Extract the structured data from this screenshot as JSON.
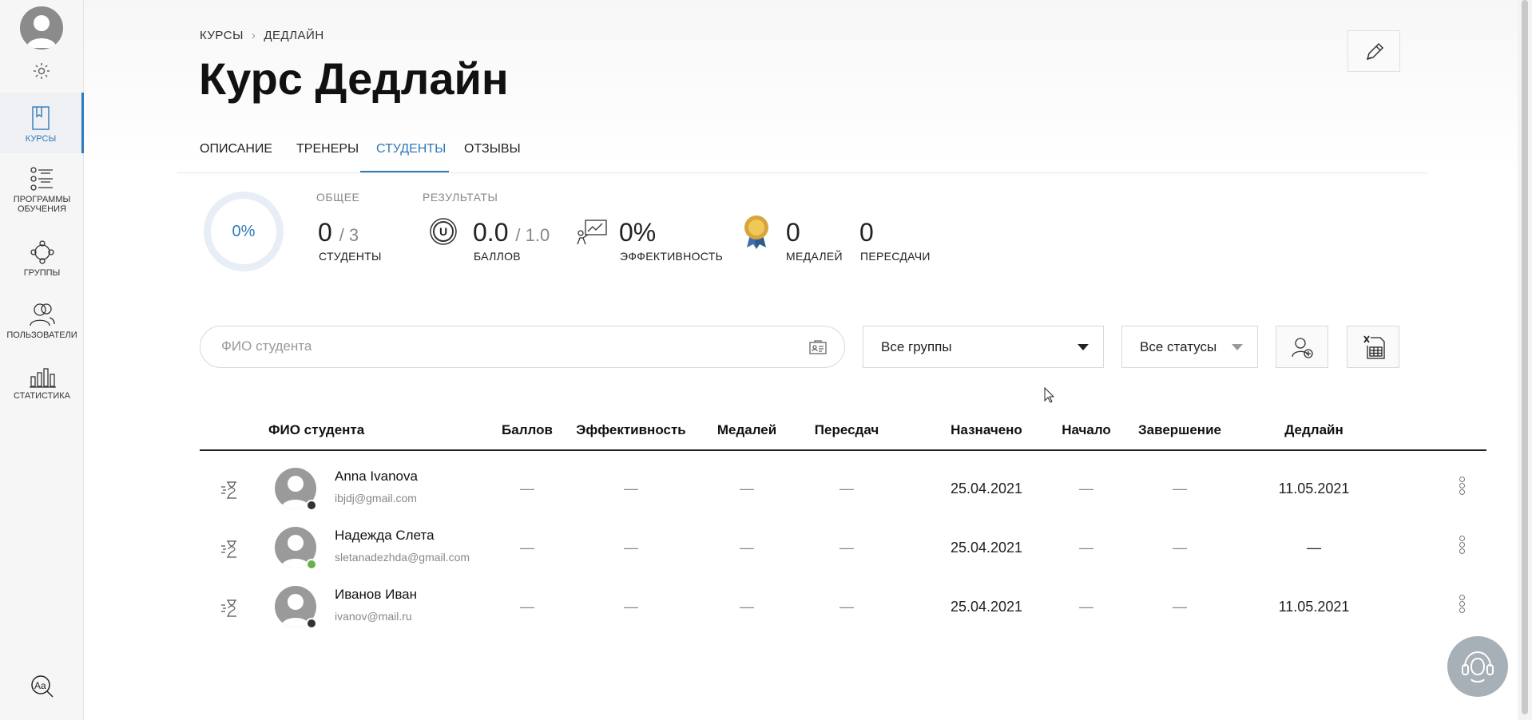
{
  "sidebar": {
    "items": [
      {
        "label": "КУРСЫ",
        "icon": "book-icon"
      },
      {
        "label": "ПРОГРАММЫ ОБУЧЕНИЯ",
        "icon": "checklist-icon"
      },
      {
        "label": "ГРУППЫ",
        "icon": "group-icon"
      },
      {
        "label": "ПОЛЬЗОВАТЕЛИ",
        "icon": "users-icon"
      },
      {
        "label": "СТАТИСТИКА",
        "icon": "bar-chart-icon"
      }
    ]
  },
  "breadcrumb": {
    "root": "КУРСЫ",
    "current": "ДЕДЛАЙН"
  },
  "page": {
    "title": "Курс Дедлайн"
  },
  "tabs": [
    {
      "label": "ОПИСАНИЕ"
    },
    {
      "label": "ТРЕНЕРЫ"
    },
    {
      "label": "СТУДЕНТЫ",
      "active": true
    },
    {
      "label": "ОТЗЫВЫ"
    }
  ],
  "stats": {
    "progress": "0%",
    "general_head": "ОБЩЕЕ",
    "students_value": "0",
    "students_of": "/ 3",
    "students_label": "СТУДЕНТЫ",
    "results_head": "РЕЗУЛЬТАТЫ",
    "points_value": "0.0",
    "points_of": "/ 1.0",
    "points_label": "БАЛЛОВ",
    "efficiency_value": "0%",
    "efficiency_label": "ЭФФЕКТИВНОСТЬ",
    "medals_value": "0",
    "medals_label": "МЕДАЛЕЙ",
    "retakes_value": "0",
    "retakes_label": "ПЕРЕСДАЧИ"
  },
  "filters": {
    "search_placeholder": "ФИО студента",
    "groups_value": "Все группы",
    "statuses_value": "Все статусы"
  },
  "table": {
    "columns": [
      "ФИО студента",
      "Баллов",
      "Эффективность",
      "Медалей",
      "Пересдач",
      "Назначено",
      "Начало",
      "Завершение",
      "Дедлайн"
    ],
    "rows": [
      {
        "name": "Anna Ivanova",
        "email": "ibjdj@gmail.com",
        "points": "—",
        "efficiency": "—",
        "medals": "—",
        "retakes": "—",
        "assigned": "25.04.2021",
        "start": "—",
        "finish": "—",
        "deadline": "11.05.2021",
        "status": "offline"
      },
      {
        "name": "Надежда Слета",
        "email": "sletanadezhda@gmail.com",
        "points": "—",
        "efficiency": "—",
        "medals": "—",
        "retakes": "—",
        "assigned": "25.04.2021",
        "start": "—",
        "finish": "—",
        "deadline": "—",
        "status": "online"
      },
      {
        "name": "Иванов Иван",
        "email": "ivanov@mail.ru",
        "points": "—",
        "efficiency": "—",
        "medals": "—",
        "retakes": "—",
        "assigned": "25.04.2021",
        "start": "—",
        "finish": "—",
        "deadline": "11.05.2021",
        "status": "offline"
      }
    ]
  },
  "colors": {
    "accent": "#2f7ab8",
    "online": "#6ab04c",
    "offline": "#333333"
  }
}
